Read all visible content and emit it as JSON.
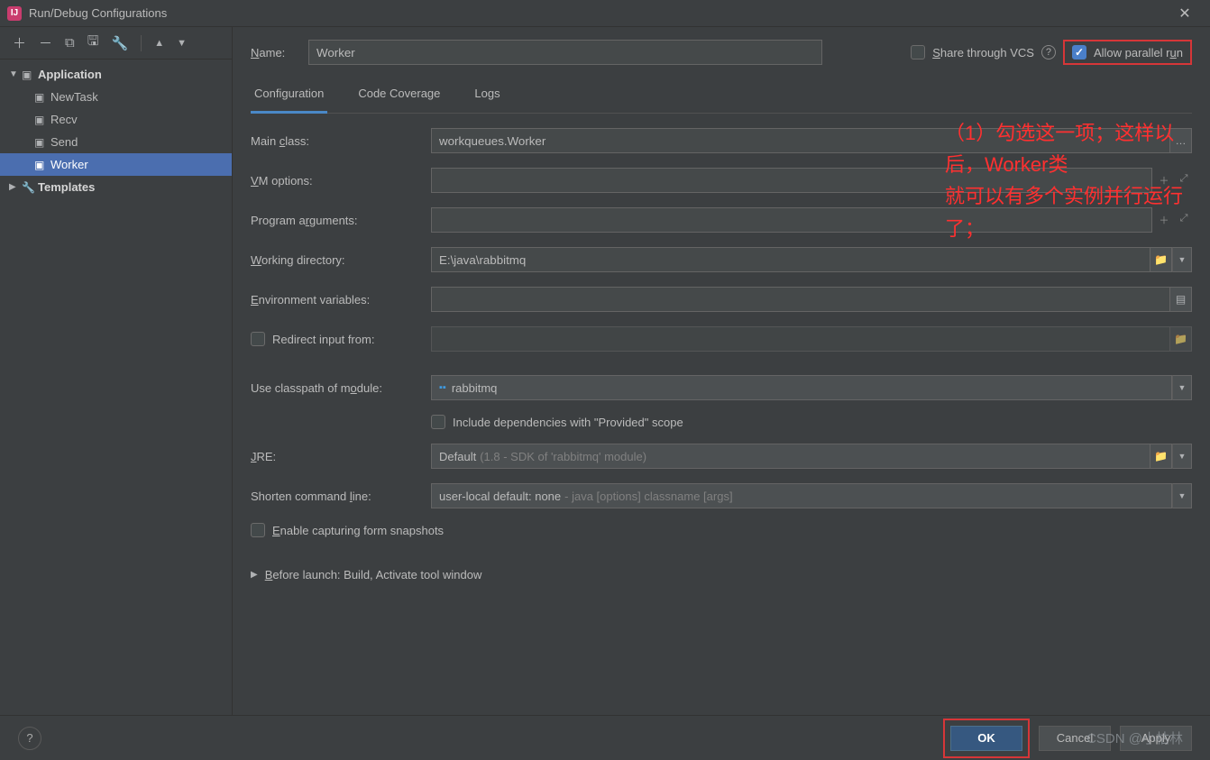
{
  "window": {
    "title": "Run/Debug Configurations"
  },
  "sidebar": {
    "nodes": [
      {
        "label": "Application",
        "bold": true
      },
      {
        "label": "NewTask"
      },
      {
        "label": "Recv"
      },
      {
        "label": "Send"
      },
      {
        "label": "Worker",
        "selected": true
      },
      {
        "label": "Templates",
        "bold": true
      }
    ]
  },
  "header": {
    "name_label": "Name:",
    "name_value": "Worker",
    "share_label": "Share through VCS",
    "allow_parallel_label": "Allow parallel run"
  },
  "tabs": [
    {
      "label": "Configuration",
      "active": true
    },
    {
      "label": "Code Coverage"
    },
    {
      "label": "Logs"
    }
  ],
  "form": {
    "main_class_label": "Main class:",
    "main_class_value": "workqueues.Worker",
    "vm_options_label": "VM options:",
    "program_args_label": "Program arguments:",
    "working_dir_label": "Working directory:",
    "working_dir_value": "E:\\java\\rabbitmq",
    "env_vars_label": "Environment variables:",
    "redirect_label": "Redirect input from:",
    "classpath_label": "Use classpath of module:",
    "classpath_value": "rabbitmq",
    "include_provided_label": "Include dependencies with \"Provided\" scope",
    "jre_label": "JRE:",
    "jre_value": "Default",
    "jre_hint": "(1.8 - SDK of 'rabbitmq' module)",
    "shorten_label": "Shorten command line:",
    "shorten_value": "user-local default: none",
    "shorten_hint": "- java [options] classname [args]",
    "enable_snapshots_label": "Enable capturing form snapshots",
    "before_launch_label": "Before launch: Build, Activate tool window"
  },
  "annotation": {
    "line1": "（1）勾选这一项；这样以后，Worker类",
    "line2": "就可以有多个实例并行运行了；"
  },
  "footer": {
    "ok": "OK",
    "cancel": "Cancel",
    "apply": "Apply"
  },
  "watermark": "CSDN @小枯林"
}
